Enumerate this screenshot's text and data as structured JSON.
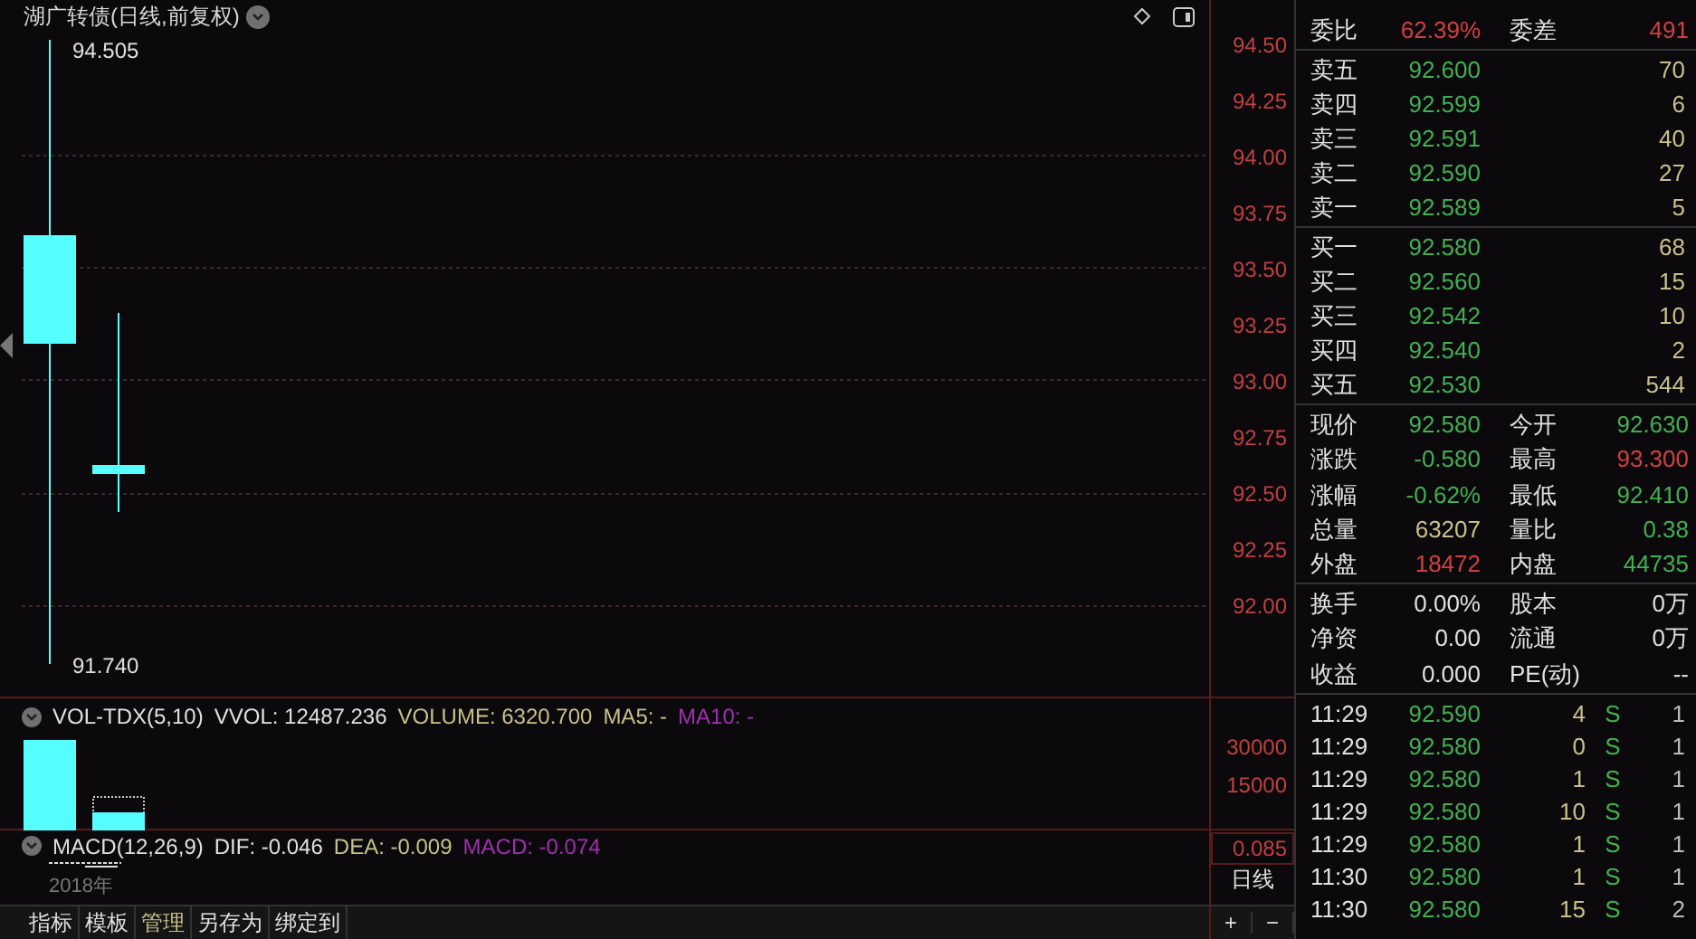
{
  "chart": {
    "title": "湖广转债(日线,前复权)",
    "high_label": "94.505",
    "low_label": "91.740",
    "price_ticks": [
      "94.50",
      "94.25",
      "94.00",
      "93.75",
      "93.50",
      "93.25",
      "93.00",
      "92.75",
      "92.50",
      "92.25",
      "92.00"
    ]
  },
  "volume": {
    "items": [
      {
        "text": "VOL-TDX(5,10)",
        "color": "#e0e0e0"
      },
      {
        "text": "VVOL: 12487.236",
        "color": "#e0e0e0"
      },
      {
        "text": "VOLUME: 6320.700",
        "color": "#c8c08a"
      },
      {
        "text": "MA5: -",
        "color": "#c8c08a"
      },
      {
        "text": "MA10: -",
        "color": "#a030b0"
      }
    ],
    "ticks": [
      "30000",
      "15000"
    ]
  },
  "macd": {
    "items": [
      {
        "text": "MACD(12,26,9)",
        "color": "#e0e0e0"
      },
      {
        "text": "DIF: -0.046",
        "color": "#e0e0e0"
      },
      {
        "text": "DEA: -0.009",
        "color": "#c8c08a"
      },
      {
        "text": "MACD: -0.074",
        "color": "#a030b0"
      }
    ],
    "ticks": [
      "0.085"
    ],
    "year": "2018年"
  },
  "period": "日线",
  "zoom_buttons": [
    "+",
    "−"
  ],
  "bottom_tabs": [
    {
      "label": "指标",
      "selected": false
    },
    {
      "label": "模板",
      "selected": false
    },
    {
      "label": "管理",
      "selected": true
    },
    {
      "label": "另存为",
      "selected": false
    },
    {
      "label": "绑定到",
      "selected": false
    }
  ],
  "ratio": {
    "left": {
      "label": "委比",
      "value": "62.39%",
      "color": "#d04040"
    },
    "right": {
      "label": "委差",
      "value": "491",
      "color": "#d04040"
    }
  },
  "asks": [
    {
      "label": "卖五",
      "price": "92.600",
      "volume": "70"
    },
    {
      "label": "卖四",
      "price": "92.599",
      "volume": "6"
    },
    {
      "label": "卖三",
      "price": "92.591",
      "volume": "40"
    },
    {
      "label": "卖二",
      "price": "92.590",
      "volume": "27"
    },
    {
      "label": "卖一",
      "price": "92.589",
      "volume": "5"
    }
  ],
  "bids": [
    {
      "label": "买一",
      "price": "92.580",
      "volume": "68"
    },
    {
      "label": "买二",
      "price": "92.560",
      "volume": "15"
    },
    {
      "label": "买三",
      "price": "92.542",
      "volume": "10"
    },
    {
      "label": "买四",
      "price": "92.540",
      "volume": "2"
    },
    {
      "label": "买五",
      "price": "92.530",
      "volume": "544"
    }
  ],
  "stats": [
    {
      "left": {
        "label": "现价",
        "value": "92.580",
        "color": "#40b050"
      },
      "right": {
        "label": "今开",
        "value": "92.630",
        "color": "#40b050"
      }
    },
    {
      "left": {
        "label": "涨跌",
        "value": "-0.580",
        "color": "#40b050"
      },
      "right": {
        "label": "最高",
        "value": "93.300",
        "color": "#d04040"
      }
    },
    {
      "left": {
        "label": "涨幅",
        "value": "-0.62%",
        "color": "#40b050"
      },
      "right": {
        "label": "最低",
        "value": "92.410",
        "color": "#40b050"
      }
    },
    {
      "left": {
        "label": "总量",
        "value": "63207",
        "color": "#c8c08a"
      },
      "right": {
        "label": "量比",
        "value": "0.38",
        "color": "#40b050"
      }
    },
    {
      "left": {
        "label": "外盘",
        "value": "18472",
        "color": "#d04040"
      },
      "right": {
        "label": "内盘",
        "value": "44735",
        "color": "#40b050"
      }
    }
  ],
  "info": [
    {
      "left": {
        "label": "换手",
        "value": "0.00%"
      },
      "right": {
        "label": "股本",
        "value": "0万"
      }
    },
    {
      "left": {
        "label": "净资",
        "value": "0.00"
      },
      "right": {
        "label": "流通",
        "value": "0万"
      }
    },
    {
      "left": {
        "label": "收益",
        "value": "0.000"
      },
      "right": {
        "label": "PE(动)",
        "value": "--"
      }
    }
  ],
  "trades": [
    {
      "time": "11:29",
      "price": "92.590",
      "volume": "4",
      "side": "S",
      "count": "1"
    },
    {
      "time": "11:29",
      "price": "92.580",
      "volume": "0",
      "side": "S",
      "count": "1"
    },
    {
      "time": "11:29",
      "price": "92.580",
      "volume": "1",
      "side": "S",
      "count": "1"
    },
    {
      "time": "11:29",
      "price": "92.580",
      "volume": "10",
      "side": "S",
      "count": "1"
    },
    {
      "time": "11:29",
      "price": "92.580",
      "volume": "1",
      "side": "S",
      "count": "1"
    },
    {
      "time": "11:30",
      "price": "92.580",
      "volume": "1",
      "side": "S",
      "count": "1"
    },
    {
      "time": "11:30",
      "price": "92.580",
      "volume": "15",
      "side": "S",
      "count": "2"
    }
  ]
}
